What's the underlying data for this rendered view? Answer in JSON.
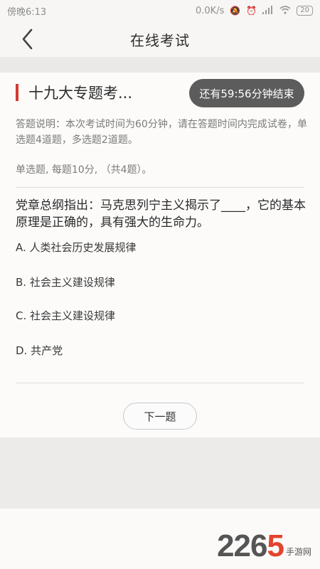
{
  "status_bar": {
    "time": "傍晚6:13",
    "speed": "0.0K/s",
    "battery": "20"
  },
  "nav": {
    "title": "在线考试"
  },
  "exam": {
    "title": "十九大专题考...",
    "timer": "还有59:56分钟结束",
    "instructions": "答题说明：本次考试时间为60分钟，请在答题时间内完成试卷，单选题4道题，多选题2道题。",
    "section_info": "单选题, 每题10分, （共4题）。",
    "question": "党章总纲指出：马克思列宁主义揭示了____，它的基本原理是正确的，具有强大的生命力。",
    "options": [
      "A. 人类社会历史发展规律",
      "B. 社会主义建设规律",
      "C. 社会主义建设规律",
      "D. 共产党"
    ],
    "next_label": "下一题"
  },
  "watermark": {
    "number_main": "226",
    "number_accent": "5",
    "site": "手游网"
  },
  "colors": {
    "accent_red": "#d33a31",
    "timer_bg": "#5c5c5c"
  }
}
